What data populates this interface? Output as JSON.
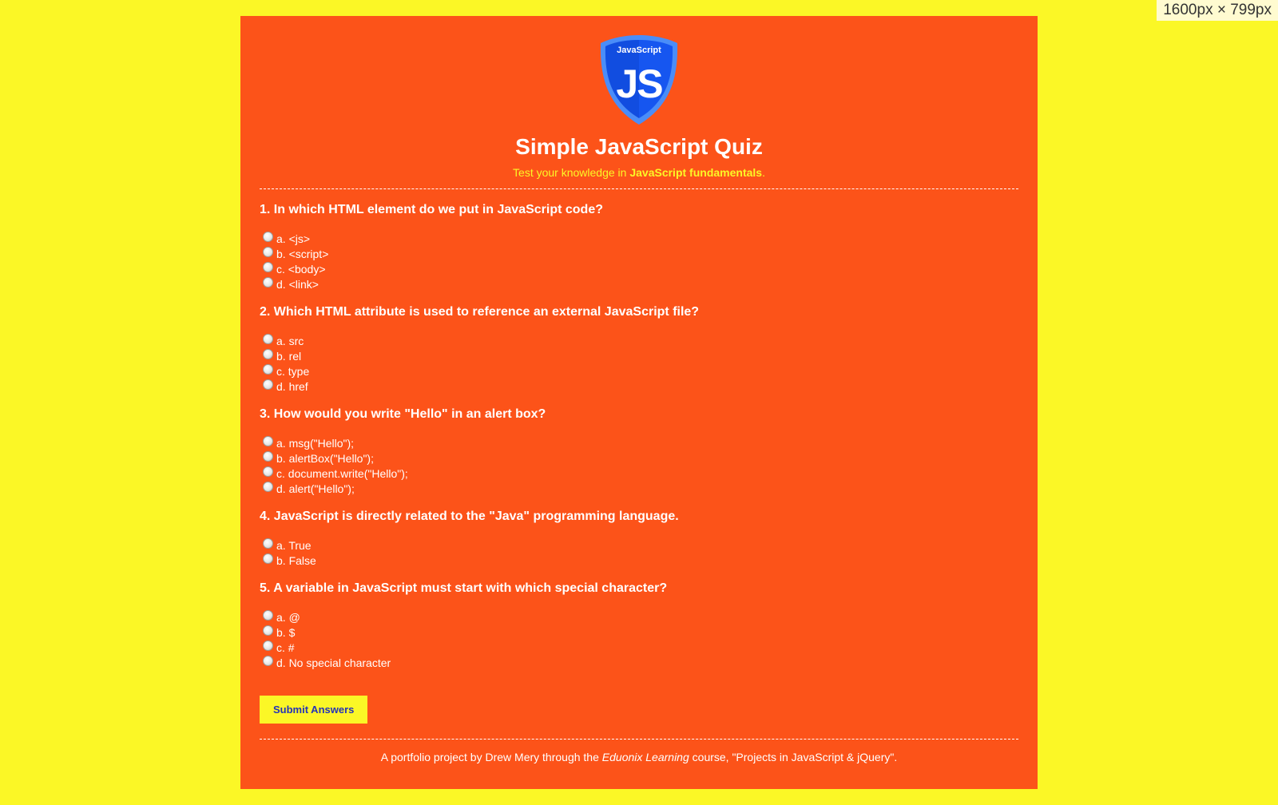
{
  "viewport_badge": "1600px × 799px",
  "header": {
    "logo_text": "JavaScript",
    "logo_letters": "JS",
    "title": "Simple JavaScript Quiz",
    "subtitle_prefix": "Test your knowledge in ",
    "subtitle_strong": "JavaScript fundamentals",
    "subtitle_suffix": "."
  },
  "questions": [
    {
      "text": "1. In which HTML element do we put in JavaScript code?",
      "answers": [
        "a. <js>",
        "b. <script>",
        "c. <body>",
        "d. <link>"
      ]
    },
    {
      "text": "2. Which HTML attribute is used to reference an external JavaScript file?",
      "answers": [
        "a. src",
        "b. rel",
        "c. type",
        "d. href"
      ]
    },
    {
      "text": "3. How would you write \"Hello\" in an alert box?",
      "answers": [
        "a. msg(\"Hello\");",
        "b. alertBox(\"Hello\");",
        "c. document.write(\"Hello\");",
        "d. alert(\"Hello\");"
      ]
    },
    {
      "text": "4. JavaScript is directly related to the \"Java\" programming language.",
      "answers": [
        "a. True",
        "b. False"
      ]
    },
    {
      "text": "5. A variable in JavaScript must start with which special character?",
      "answers": [
        "a. @",
        "b. $",
        "c. #",
        "d. No special character"
      ]
    }
  ],
  "submit_label": "Submit Answers",
  "footer": {
    "prefix": "A portfolio project by Drew Mery through the ",
    "italic": "Eduonix Learning",
    "suffix": " course, \"Projects in JavaScript & jQuery\"."
  },
  "colors": {
    "page_background": "#fbf726",
    "panel_background": "#fc5319",
    "accent_yellow": "#fbf726",
    "button_text": "#2433b8",
    "logo_blue": "#1656f0"
  }
}
